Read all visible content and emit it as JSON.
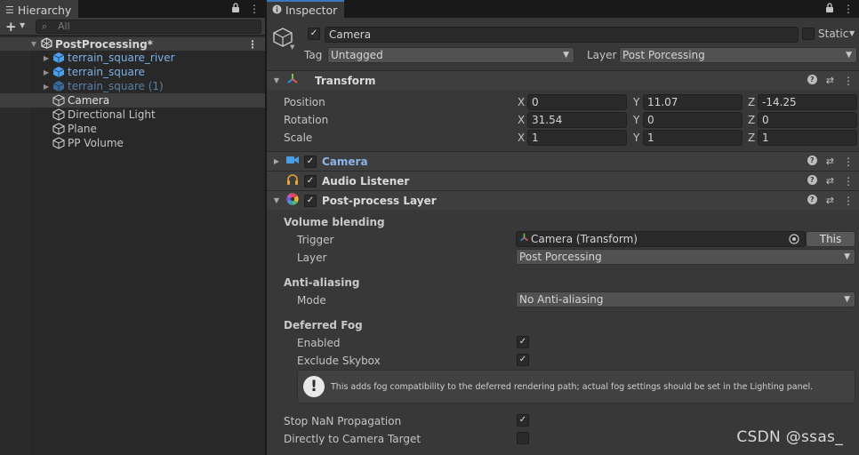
{
  "hierarchy": {
    "tab_label": "Hierarchy",
    "search_placeholder": "All",
    "scene_name": "PostProcessing*",
    "items": [
      {
        "label": "terrain_square_river",
        "kind": "prefab"
      },
      {
        "label": "terrain_square",
        "kind": "prefab"
      },
      {
        "label": "terrain_square (1)",
        "kind": "prefab-inactive"
      },
      {
        "label": "Camera",
        "kind": "object",
        "selected": true
      },
      {
        "label": "Directional Light",
        "kind": "object"
      },
      {
        "label": "Plane",
        "kind": "object"
      },
      {
        "label": "PP Volume",
        "kind": "object"
      }
    ]
  },
  "inspector": {
    "tab_label": "Inspector",
    "object_name": "Camera",
    "object_active": true,
    "static_label": "Static",
    "static_checked": false,
    "tag_label": "Tag",
    "tag_value": "Untagged",
    "layer_label": "Layer",
    "layer_value": "Post Porcessing",
    "transform": {
      "title": "Transform",
      "position_label": "Position",
      "rotation_label": "Rotation",
      "scale_label": "Scale",
      "axis_x": "X",
      "axis_y": "Y",
      "axis_z": "Z",
      "position": {
        "x": "0",
        "y": "11.07",
        "z": "-14.25"
      },
      "rotation": {
        "x": "31.54",
        "y": "0",
        "z": "0"
      },
      "scale": {
        "x": "1",
        "y": "1",
        "z": "1"
      }
    },
    "components": {
      "camera_title": "Camera",
      "audio_title": "Audio Listener",
      "postprocess_title": "Post-process Layer"
    },
    "post_process": {
      "volume_blending_label": "Volume blending",
      "trigger_label": "Trigger",
      "trigger_value": "Camera (Transform)",
      "this_button": "This",
      "layer_label": "Layer",
      "layer_value": "Post Porcessing",
      "anti_aliasing_label": "Anti-aliasing",
      "mode_label": "Mode",
      "mode_value": "No Anti-aliasing",
      "deferred_fog_label": "Deferred Fog",
      "enabled_label": "Enabled",
      "enabled_checked": true,
      "exclude_skybox_label": "Exclude Skybox",
      "exclude_skybox_checked": true,
      "help_text": "This adds fog compatibility to the deferred rendering path; actual fog settings should be set in the Lighting panel.",
      "stop_nan_label": "Stop NaN Propagation",
      "stop_nan_checked": true,
      "direct_camera_label": "Directly to Camera Target",
      "direct_camera_checked": false
    }
  },
  "watermark": "CSDN @ssas_",
  "colors": {
    "prefab_blue": "#7bafe4",
    "accent_tab": "#3a79bb",
    "camera_title_blue": "#8ab4ea"
  }
}
